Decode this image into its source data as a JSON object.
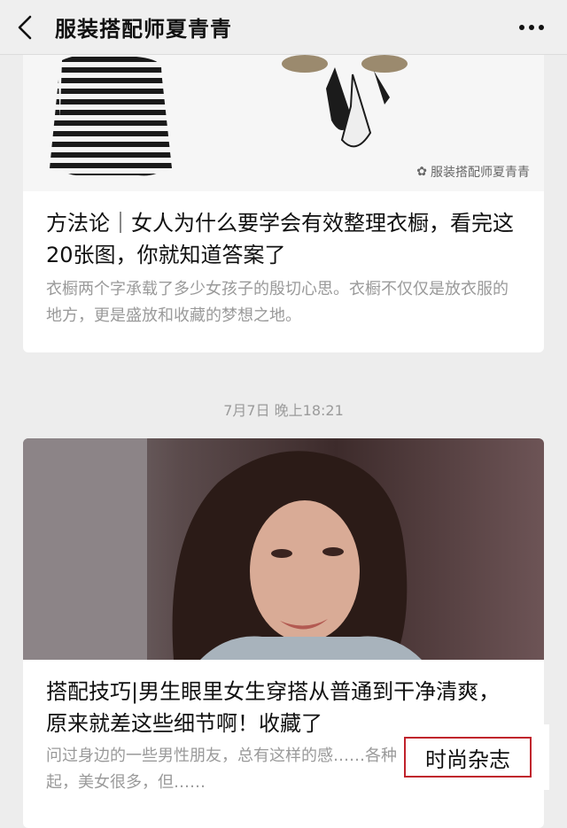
{
  "header": {
    "title": "服装搭配师夏青青",
    "back_icon": "chevron-left-icon",
    "more_icon": "more-dots-icon"
  },
  "articles": [
    {
      "watermark": "服装搭配师夏青青",
      "title": "方法论｜女人为什么要学会有效整理衣橱，看完这20张图，你就知道答案了",
      "desc": "衣橱两个字承载了多少女孩子的殷切心思。衣橱不仅仅是放衣服的地方，更是盛放和收藏的梦想之地。"
    },
    {
      "title": "搭配技巧|男生眼里女生穿搭从普通到干净清爽，原来就差这些细节啊！收藏了",
      "desc": "问过身边的一些男性朋友，总有这样的感……各种网络平台日益崛起，美女很多，但……"
    }
  ],
  "timestamp": "7月7日 晚上18:21",
  "magazine_label": "时尚杂志",
  "colors": {
    "background": "#ededed",
    "accent_border": "#c0222c",
    "desc_text": "#9a9a9a"
  }
}
